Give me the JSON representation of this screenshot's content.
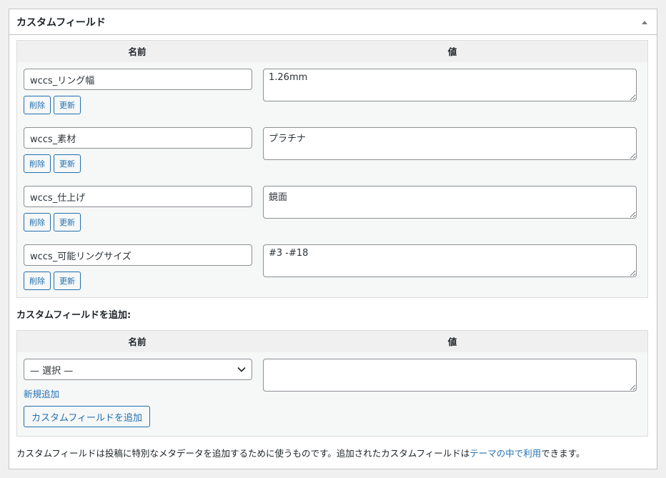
{
  "box": {
    "title": "カスタムフィールド",
    "toggle_icon": "triangle-up-icon"
  },
  "existing": {
    "headers": {
      "name": "名前",
      "value": "値"
    },
    "rows": [
      {
        "name": "wccs_リング幅",
        "value": "1.26mm",
        "delete_label": "削除",
        "update_label": "更新"
      },
      {
        "name": "wccs_素材",
        "value": "プラチナ",
        "delete_label": "削除",
        "update_label": "更新"
      },
      {
        "name": "wccs_仕上げ",
        "value": "鏡面",
        "delete_label": "削除",
        "update_label": "更新"
      },
      {
        "name": "wccs_可能リングサイズ",
        "value": "#3 -#18",
        "delete_label": "削除",
        "update_label": "更新"
      }
    ]
  },
  "add_new": {
    "heading": "カスタムフィールドを追加:",
    "headers": {
      "name": "名前",
      "value": "値"
    },
    "select_value": "— 選択 —",
    "value": "",
    "new_link": "新規追加",
    "add_button": "カスタムフィールドを追加"
  },
  "footer": {
    "text_before": "カスタムフィールドは投稿に特別なメタデータを追加するために使うものです。追加されたカスタムフィールドは",
    "link": "テーマの中で利用",
    "text_after": "できます。"
  },
  "colors": {
    "accent": "#2271b1",
    "border": "#c3c4c7"
  }
}
